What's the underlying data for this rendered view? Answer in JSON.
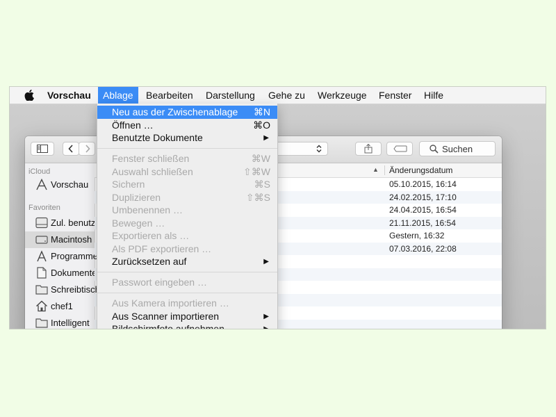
{
  "menubar": {
    "app_name": "Vorschau",
    "items": [
      "Ablage",
      "Bearbeiten",
      "Darstellung",
      "Gehe zu",
      "Werkzeuge",
      "Fenster",
      "Hilfe"
    ]
  },
  "menu": {
    "items": [
      {
        "label": "Neu aus der Zwischenablage",
        "shortcut": "⌘N"
      },
      {
        "label": "Öffnen …",
        "shortcut": "⌘O"
      },
      {
        "label": "Benutzte Dokumente",
        "shortcut": ""
      },
      {
        "label": "Fenster schließen",
        "shortcut": "⌘W"
      },
      {
        "label": "Auswahl schließen",
        "shortcut": "⇧⌘W"
      },
      {
        "label": "Sichern",
        "shortcut": "⌘S"
      },
      {
        "label": "Duplizieren",
        "shortcut": "⇧⌘S"
      },
      {
        "label": "Umbenennen …",
        "shortcut": ""
      },
      {
        "label": "Bewegen …",
        "shortcut": ""
      },
      {
        "label": "Exportieren als …",
        "shortcut": ""
      },
      {
        "label": "Als PDF exportieren …",
        "shortcut": ""
      },
      {
        "label": "Zurücksetzen auf",
        "shortcut": ""
      },
      {
        "label": "Passwort eingeben …",
        "shortcut": ""
      },
      {
        "label": "Aus Kamera importieren …",
        "shortcut": ""
      },
      {
        "label": "Aus Scanner importieren",
        "shortcut": ""
      },
      {
        "label": "Bildschirmfoto aufnehmen",
        "shortcut": ""
      }
    ]
  },
  "toolbar": {
    "search_label": "Suchen"
  },
  "sidebar": {
    "icloud_header": "iCloud",
    "favorites_header": "Favoriten",
    "items": [
      "Vorschau",
      "Zul. benutzt",
      "Macintosh",
      "Programme",
      "Dokumente",
      "Schreibtisch",
      "chef1",
      "Intelligent"
    ]
  },
  "table": {
    "date_header": "Änderungsdatum",
    "dates": [
      "05.10.2015, 16:14",
      "24.02.2015, 17:10",
      "24.04.2015, 16:54",
      "21.11.2015, 16:54",
      "Gestern, 16:32",
      "07.03.2016, 22:08"
    ]
  },
  "colors": {
    "accent": "#3b8cf6",
    "page_background": "#f1fde6"
  }
}
